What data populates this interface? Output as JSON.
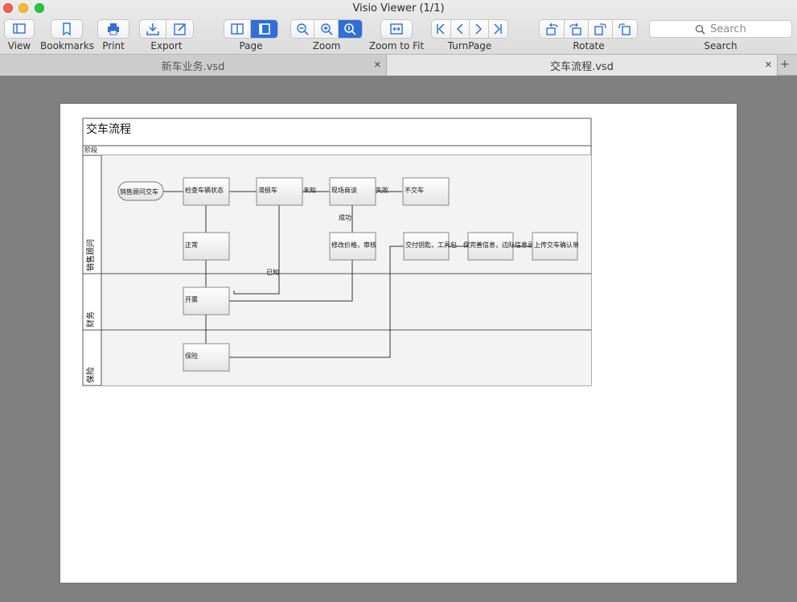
{
  "window": {
    "title": "Visio Viewer (1/1)"
  },
  "toolbar": {
    "view_label": "View",
    "bookmarks_label": "Bookmarks",
    "print_label": "Print",
    "export_label": "Export",
    "page_label": "Page",
    "zoom_label": "Zoom",
    "zoom_to_fit_label": "Zoom to Fit",
    "turnpage_label": "TurnPage",
    "rotate_label": "Rotate",
    "search_label": "Search",
    "search_placeholder": "Search"
  },
  "tabs": [
    {
      "label": "新车业务.vsd",
      "active": false
    },
    {
      "label": "交车流程.vsd",
      "active": true
    }
  ],
  "diagram": {
    "title": "交车流程",
    "phase_label": "阶段",
    "lanes": [
      "销售顾问",
      "财务",
      "保险"
    ],
    "boxes": {
      "start": "销售顾问交车",
      "check": "检查车辆状态",
      "stale": "滞损车",
      "negotiate": "现场商谈",
      "no_delivery": "不交车",
      "normal": "正常",
      "modify": "修改价格，审核",
      "keys": "交付钥匙，工具包",
      "perfect": "保完善信息，边际信息录",
      "upload": "上传交车确认单",
      "invoice": "开票",
      "insurance": "保险"
    },
    "edge_labels": {
      "unknown": "未知",
      "fail": "失败",
      "success": "成功",
      "known": "已知"
    }
  },
  "colors": {
    "accent": "#2f6fd6",
    "canvas_bg": "#808080"
  }
}
